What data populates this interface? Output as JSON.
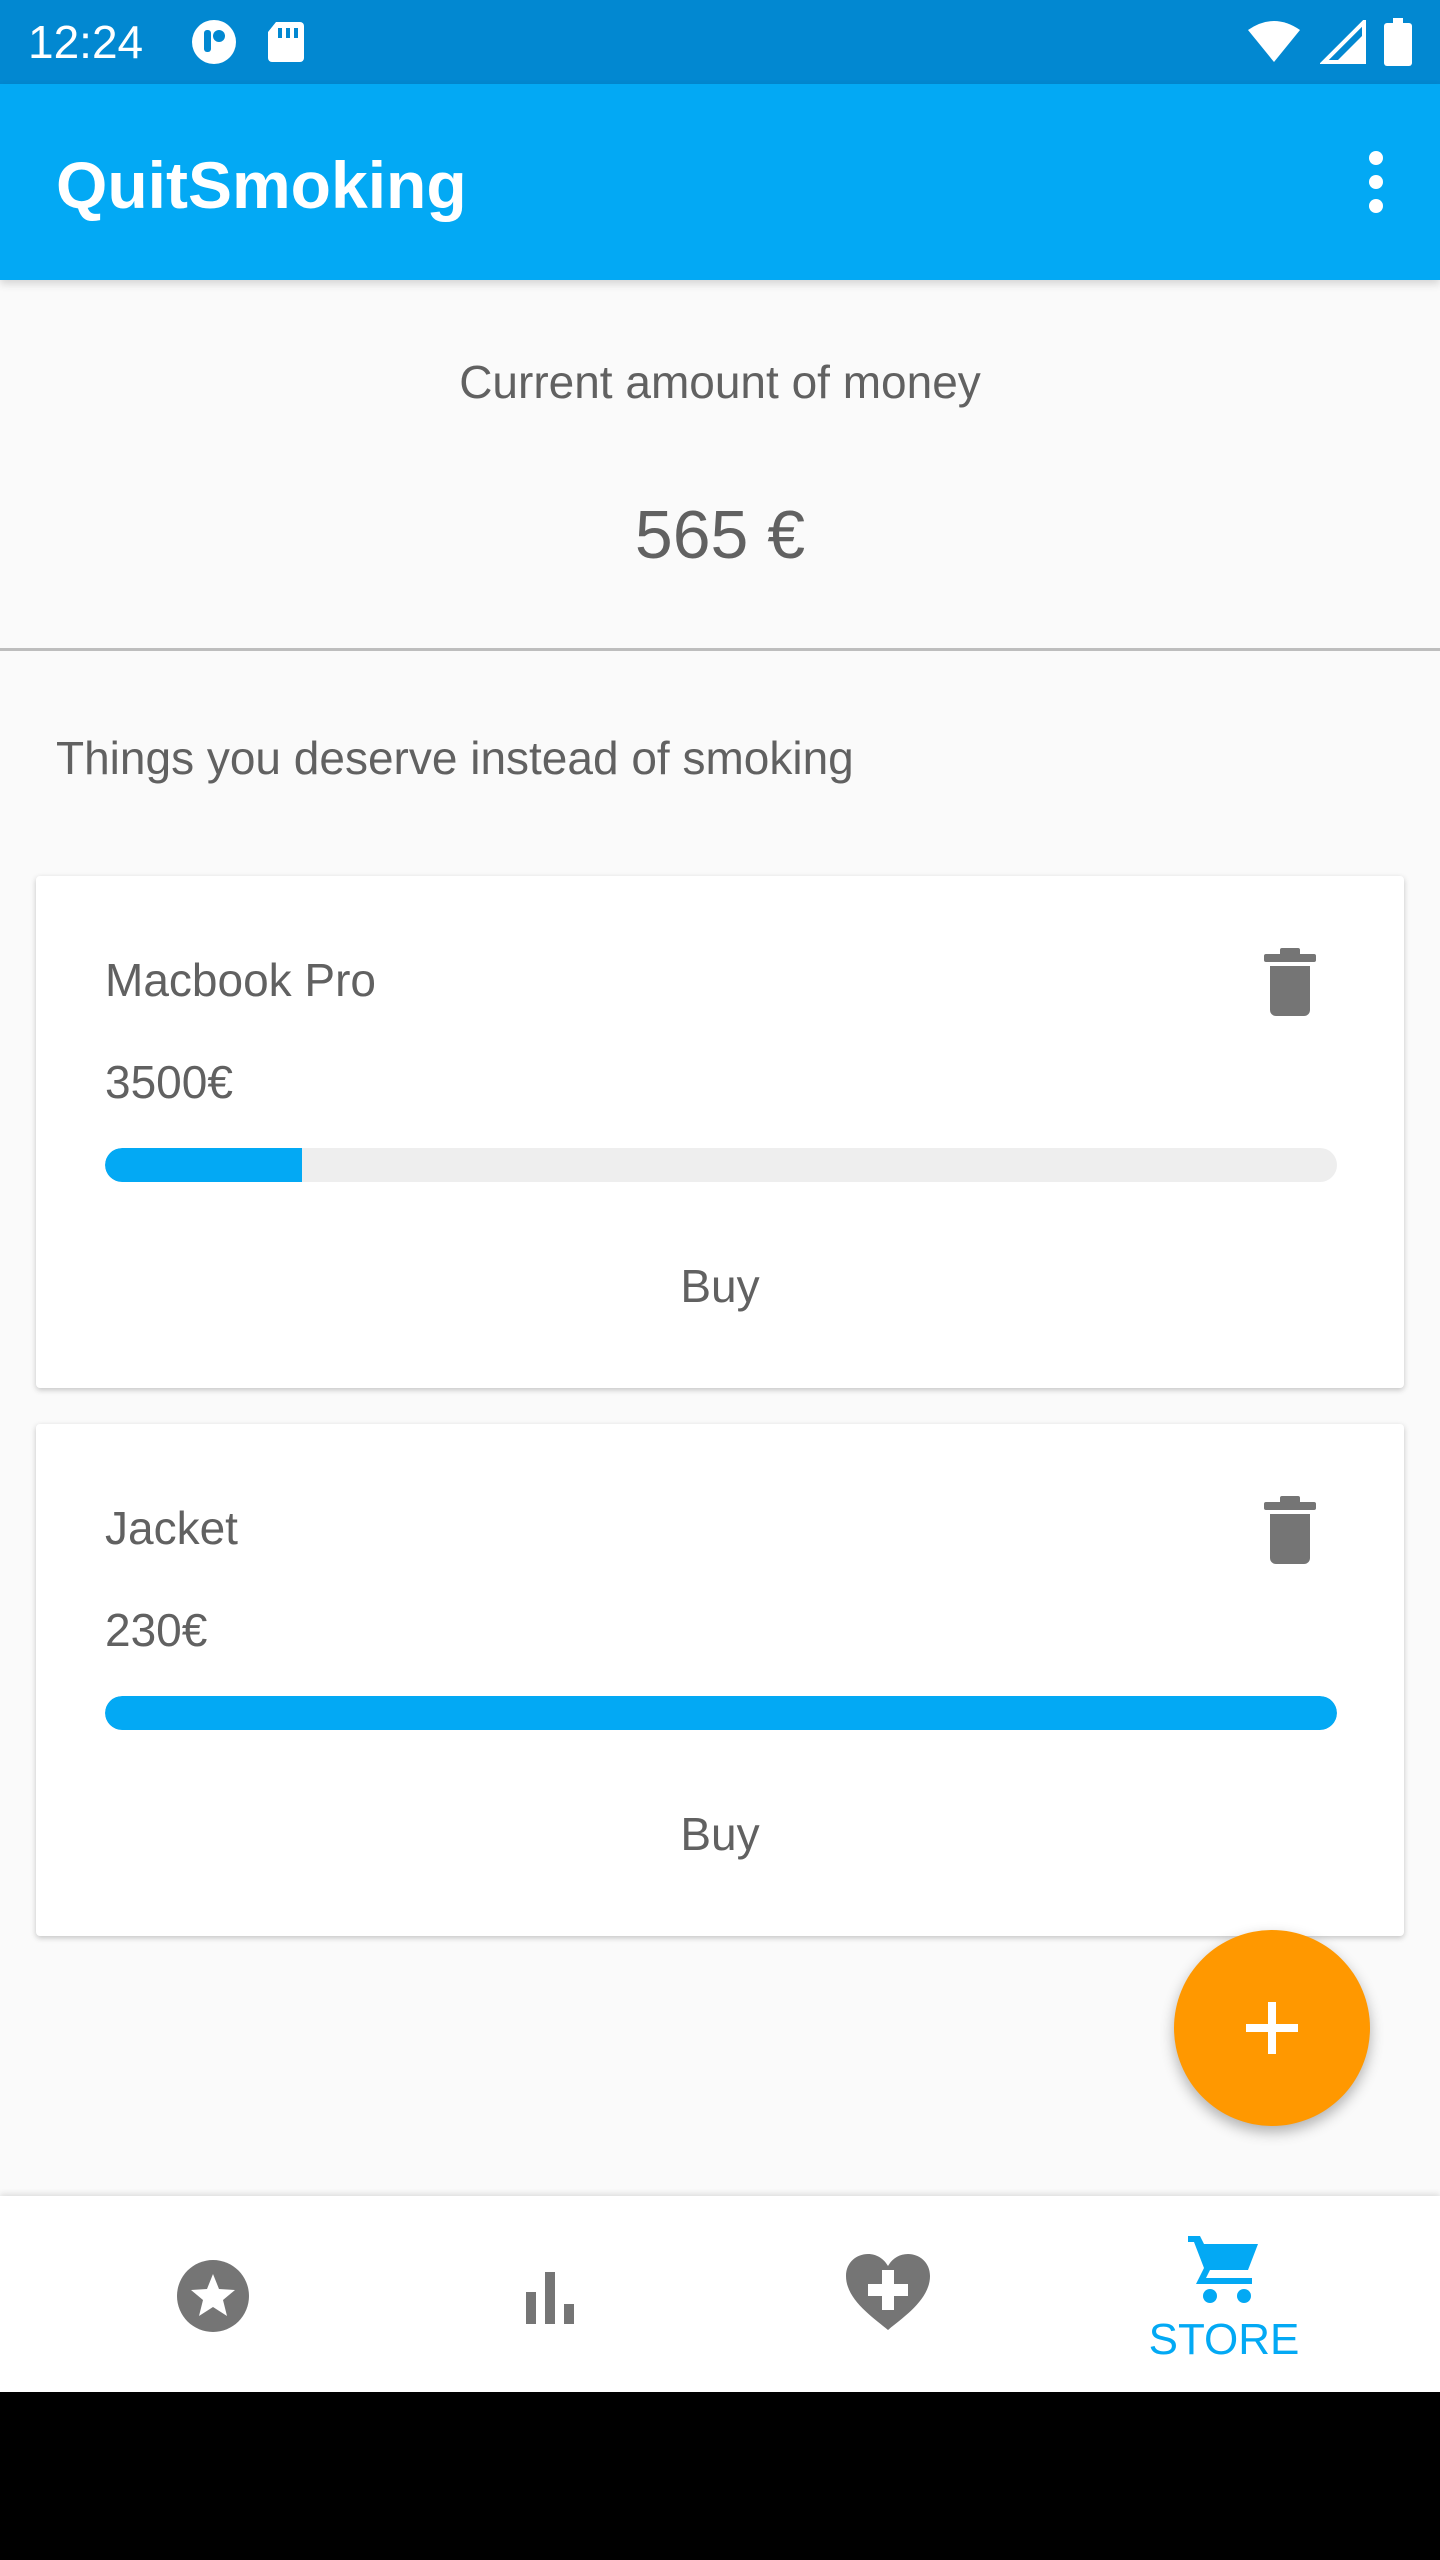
{
  "status_bar": {
    "time": "12:24",
    "left_icons": [
      "notification-icon",
      "sd-card-icon"
    ],
    "right_icons": [
      "wifi-icon",
      "cell-signal-icon",
      "battery-icon"
    ]
  },
  "app_bar": {
    "title": "QuitSmoking",
    "menu_icon": "more-vert-icon"
  },
  "money": {
    "label": "Current amount of money",
    "value": "565 €"
  },
  "section_heading": "Things you deserve instead of smoking",
  "items": [
    {
      "name": "Macbook Pro",
      "price": "3500€",
      "progress": 0.16,
      "buy_label": "Buy"
    },
    {
      "name": "Jacket",
      "price": "230€",
      "progress": 1.0,
      "buy_label": "Buy"
    }
  ],
  "fab": {
    "icon": "plus-icon"
  },
  "bottom_nav": [
    {
      "icon": "star-icon",
      "label": "",
      "active": false
    },
    {
      "icon": "bar-chart-icon",
      "label": "",
      "active": false
    },
    {
      "icon": "heart-plus-icon",
      "label": "",
      "active": false
    },
    {
      "icon": "cart-icon",
      "label": "STORE",
      "active": true
    }
  ],
  "colors": {
    "status_bar": "#0288d1",
    "primary": "#03a9f4",
    "accent": "#ff9800",
    "text": "#616161",
    "icon": "#757575"
  }
}
